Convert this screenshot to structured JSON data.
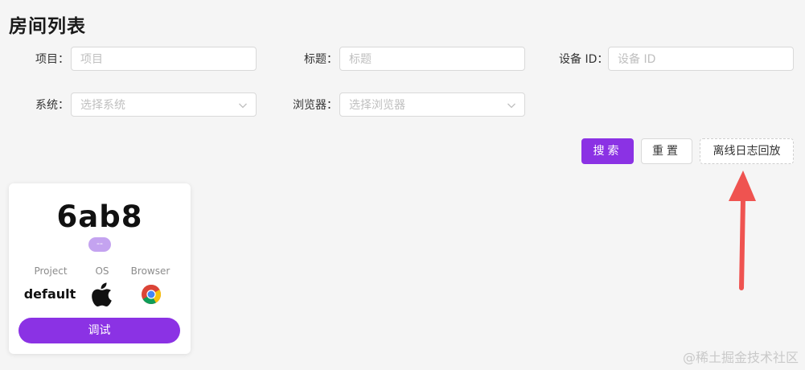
{
  "page": {
    "title": "房间列表"
  },
  "filters": {
    "project": {
      "label": "项目",
      "colon": "：",
      "placeholder": "项目"
    },
    "title": {
      "label": "标题",
      "colon": "：",
      "placeholder": "标题"
    },
    "device_id": {
      "label": "设备 ID",
      "colon": "：",
      "placeholder": "设备 ID"
    },
    "system": {
      "label": "系统",
      "colon": "：",
      "placeholder": "选择系统"
    },
    "browser": {
      "label": "浏览器",
      "colon": "：",
      "placeholder": "选择浏览器"
    }
  },
  "actions": {
    "search_label": "搜索",
    "reset_label": "重置",
    "offline_replay_label": "离线日志回放"
  },
  "room_card": {
    "id": "6ab8",
    "status_badge": "--",
    "project_label": "Project",
    "os_label": "OS",
    "browser_label": "Browser",
    "project_value": "default",
    "os_icon": "apple-icon",
    "browser_icon": "chrome-icon",
    "debug_label": "调试"
  },
  "watermark": "@稀土掘金技术社区",
  "colors": {
    "accent": "#8b32e4",
    "badge": "#c4a3f0",
    "annotation_arrow": "#ef5350"
  }
}
